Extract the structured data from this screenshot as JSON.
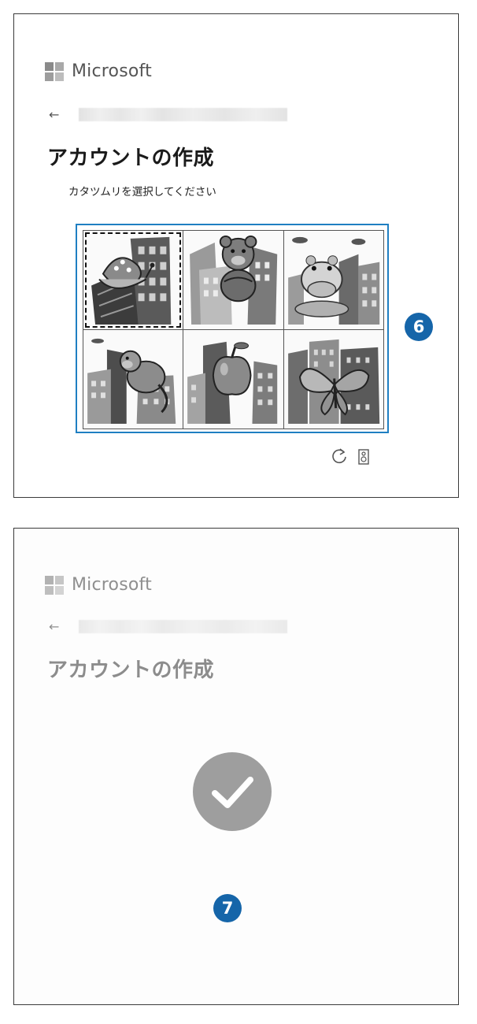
{
  "top_panel": {
    "brand": "Microsoft",
    "back_icon": "arrow-left-icon",
    "title": "アカウントの作成",
    "instruction": "カタツムリを選択してください",
    "tiles": [
      {
        "icon": "snail-icon",
        "selected": true
      },
      {
        "icon": "bear-icon",
        "selected": false
      },
      {
        "icon": "hippo-icon",
        "selected": false
      },
      {
        "icon": "monkey-icon",
        "selected": false
      },
      {
        "icon": "apple-icon",
        "selected": false
      },
      {
        "icon": "butterfly-icon",
        "selected": false
      }
    ],
    "callout": "6",
    "refresh_icon": "refresh-icon",
    "audio_icon": "speaker-icon"
  },
  "bottom_panel": {
    "brand": "Microsoft",
    "back_icon": "arrow-left-icon",
    "title": "アカウントの作成",
    "status_icon": "checkmark-icon",
    "callout": "7"
  },
  "colors": {
    "highlight_frame": "#1f7fc2",
    "callout": "#1565a9",
    "check_circle": "#9e9e9e"
  }
}
